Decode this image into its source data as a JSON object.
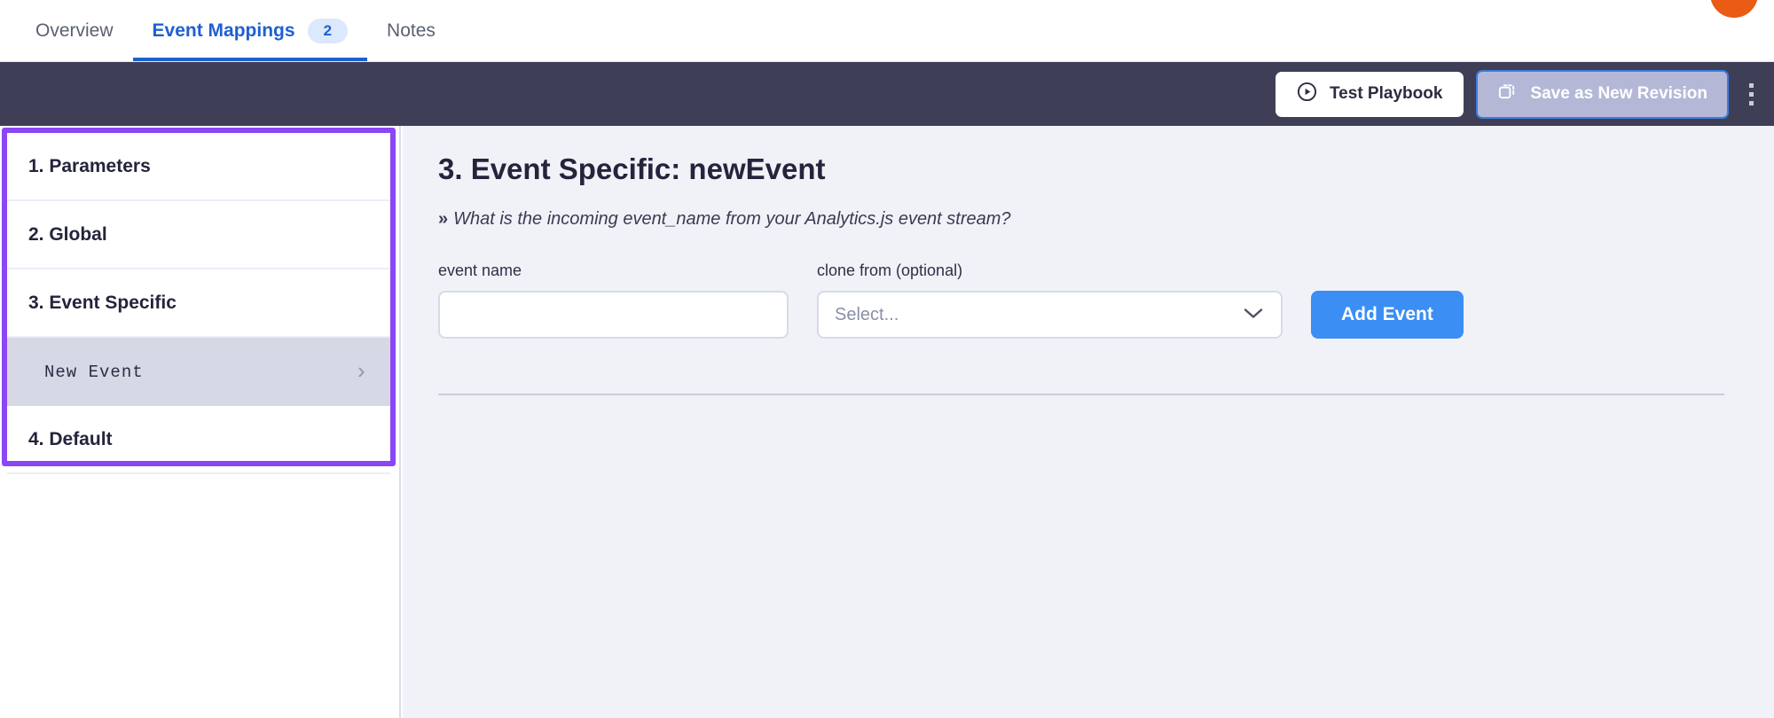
{
  "tabs": [
    {
      "label": "Overview",
      "active": false,
      "badge": null
    },
    {
      "label": "Event Mappings",
      "active": true,
      "badge": "2"
    },
    {
      "label": "Notes",
      "active": false,
      "badge": null
    }
  ],
  "toolbar": {
    "test_playbook_label": "Test Playbook",
    "test_playbook_icon": "play-circle-icon",
    "save_revision_label": "Save as New Revision",
    "save_revision_icon": "duplicate-icon",
    "overflow_icon": "kebab-menu-icon"
  },
  "avatar": {
    "icon": "user-avatar",
    "color": "#ea5b16"
  },
  "sidebar": {
    "highlight_color": "#8b46f5",
    "items": [
      {
        "label": "1. Parameters",
        "type": "section",
        "selected": false
      },
      {
        "label": "2. Global",
        "type": "section",
        "selected": false
      },
      {
        "label": "3. Event Specific",
        "type": "section",
        "selected": false
      },
      {
        "label": "New Event",
        "type": "sub",
        "selected": true,
        "chevron": "›"
      },
      {
        "label": "4. Default",
        "type": "section",
        "selected": false
      }
    ]
  },
  "main": {
    "title": "3. Event Specific: newEvent",
    "prompt_caret": "»",
    "prompt": "What is the incoming event_name from your Analytics.js event stream?",
    "event_name": {
      "label": "event name",
      "value": "",
      "placeholder": ""
    },
    "clone_from": {
      "label": "clone from (optional)",
      "value": "Select...",
      "chevron_icon": "chevron-down-icon"
    },
    "add_event_label": "Add Event"
  },
  "colors": {
    "accent_blue": "#3b8ef4",
    "tab_active": "#1f5fd0",
    "toolbar_dark": "#3e3f57",
    "highlight_purple": "#8b46f5",
    "main_bg": "#f1f2f7"
  }
}
